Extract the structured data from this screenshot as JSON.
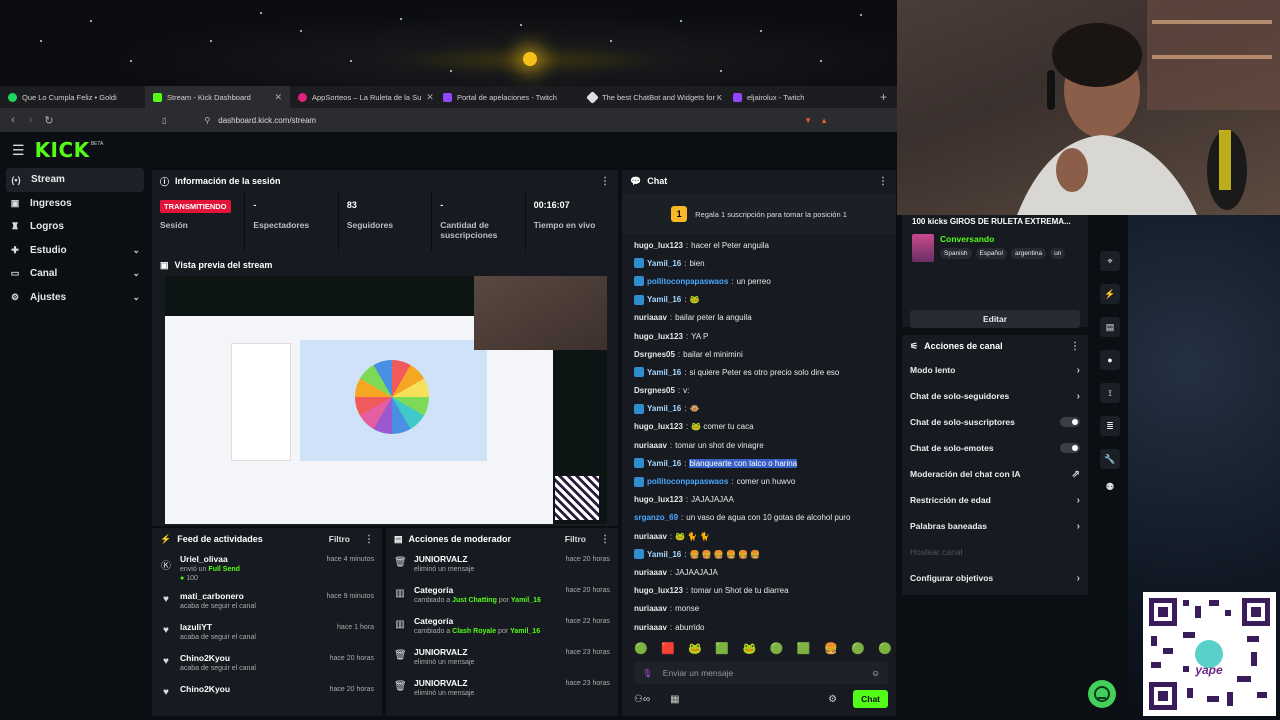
{
  "browser": {
    "tabs": [
      {
        "label": "Que Lo Cumpla Feliz • Goldi",
        "color": "#1ed760"
      },
      {
        "label": "Stream - Kick Dashboard",
        "color": "#53fc18"
      },
      {
        "label": "AppSorteos – La Ruleta de la Su",
        "color": "#e0207d"
      },
      {
        "label": "Portal de apelaciones - Twitch",
        "color": "#9146ff"
      },
      {
        "label": "The best ChatBot and Widgets for K",
        "color": "#dddddd"
      },
      {
        "label": "eljairolux - Twitch",
        "color": "#9146ff"
      }
    ],
    "url": "dashboard.kick.com/stream"
  },
  "kick": {
    "logo": "KICK",
    "beta": "BETA"
  },
  "sidebar": {
    "items": [
      {
        "label": "Stream"
      },
      {
        "label": "Ingresos"
      },
      {
        "label": "Logros"
      },
      {
        "label": "Estudio"
      },
      {
        "label": "Canal"
      },
      {
        "label": "Ajustes"
      }
    ]
  },
  "session": {
    "title": "Información de la sesión",
    "status": "TRANSMITIENDO",
    "status_label": "Sesión",
    "viewers_value": "-",
    "viewers_label": "Espectadores",
    "followers_value": "83",
    "followers_label": "Seguidores",
    "subs_value": "-",
    "subs_label": "Cantidad de suscripciones",
    "live_value": "00:16:07",
    "live_label": "Tiempo en vivo"
  },
  "preview": {
    "title": "Vista previa del stream"
  },
  "feed": {
    "title": "Feed de actividades",
    "filter": "Filtro",
    "items": [
      {
        "name": "Uriel_olivaa",
        "desc_pre": "envió un ",
        "desc_hl": "Full Send",
        "extra": "100",
        "time": "hace 4 minutos"
      },
      {
        "name": "mati_carbonero",
        "desc": "acaba de seguir el canal",
        "time": "hace 9 minutos"
      },
      {
        "name": "lazuliYT",
        "desc": "acaba de seguir el canal",
        "time": "hace 1 hora"
      },
      {
        "name": "Chino2Kyou",
        "desc": "acaba de seguir el canal",
        "time": "hace 20 horas"
      },
      {
        "name": "Chino2Kyou",
        "desc": "",
        "time": "hace 20 horas"
      }
    ]
  },
  "modactions": {
    "title": "Acciones de moderador",
    "filter": "Filtro",
    "items": [
      {
        "name": "JUNIORVALZ",
        "desc": "eliminó un mensaje",
        "time": "hace 20 horas"
      },
      {
        "name": "Categoría",
        "desc_pre": "cambiado a ",
        "desc_hl": "Just Chatting",
        "desc_mid": " por ",
        "desc_user": "Yamil_16",
        "time": "hace 20 horas"
      },
      {
        "name": "Categoría",
        "desc_pre": "cambiado a ",
        "desc_hl": "Clash Royale",
        "desc_mid": " por ",
        "desc_user": "Yamil_16",
        "time": "hace 22 horas"
      },
      {
        "name": "JUNIORVALZ",
        "desc": "eliminó un mensaje",
        "time": "hace 23 horas"
      },
      {
        "name": "JUNIORVALZ",
        "desc": "eliminó un mensaje",
        "time": "hace 23 horas"
      }
    ]
  },
  "chat": {
    "title": "Chat",
    "pin_number": "1",
    "pin_text": "Regala 1 suscripción para tomar la posición 1",
    "messages": [
      {
        "user": "hugo_lux123",
        "color": "#e7e7e7",
        "badge": false,
        "text": "hacer el Peter anguila"
      },
      {
        "user": "Yamil_16",
        "color": "#a6d8ff",
        "badge": true,
        "text": "bien"
      },
      {
        "user": "pollitoconpapaswaos",
        "color": "#4aa8ff",
        "badge": true,
        "text": "un perreo"
      },
      {
        "user": "Yamil_16",
        "color": "#a6d8ff",
        "badge": true,
        "text": "🐸"
      },
      {
        "user": "nuriaaav",
        "color": "#e7e7e7",
        "badge": false,
        "text": "bailar peter la anguila"
      },
      {
        "user": "hugo_lux123",
        "color": "#e7e7e7",
        "badge": false,
        "text": "YA P"
      },
      {
        "user": "Dsrgnes05",
        "color": "#e7e7e7",
        "badge": false,
        "text": "bailar el minimini"
      },
      {
        "user": "Yamil_16",
        "color": "#a6d8ff",
        "badge": true,
        "text": "si quiere Peter es otro precio solo dire eso"
      },
      {
        "user": "Dsrgnes05",
        "color": "#e7e7e7",
        "badge": false,
        "text": "v:"
      },
      {
        "user": "Yamil_16",
        "color": "#a6d8ff",
        "badge": true,
        "text": "🐵"
      },
      {
        "user": "hugo_lux123",
        "color": "#e7e7e7",
        "badge": false,
        "text": "🐸 comer tu caca"
      },
      {
        "user": "nuriaaav",
        "color": "#e7e7e7",
        "badge": false,
        "text": "tomar un shot de vinagre"
      },
      {
        "user": "Yamil_16",
        "color": "#a6d8ff",
        "badge": true,
        "text": "blanquearte con talco o harina",
        "highlight": true
      },
      {
        "user": "pollitoconpapaswaos",
        "color": "#4aa8ff",
        "badge": true,
        "text": "comer un huwvo"
      },
      {
        "user": "hugo_lux123",
        "color": "#e7e7e7",
        "badge": false,
        "text": "JAJAJAJAA"
      },
      {
        "user": "srganzo_69",
        "color": "#4aa8ff",
        "badge": false,
        "text": "un vaso de agua con 10 gotas de alcohol puro"
      },
      {
        "user": "nuriaaav",
        "color": "#e7e7e7",
        "badge": false,
        "text": "🐸 🐈 🐈"
      },
      {
        "user": "Yamil_16",
        "color": "#a6d8ff",
        "badge": true,
        "text": "🍔 🍔 🍔 🍔 🍔 🍔"
      },
      {
        "user": "nuriaaav",
        "color": "#e7e7e7",
        "badge": false,
        "text": "JAJAAJAJA"
      },
      {
        "user": "hugo_lux123",
        "color": "#e7e7e7",
        "badge": false,
        "text": "tomar un Shot de tu diarrea"
      },
      {
        "user": "nuriaaav",
        "color": "#e7e7e7",
        "badge": false,
        "text": "monse"
      },
      {
        "user": "nuriaaav",
        "color": "#e7e7e7",
        "badge": false,
        "text": "aburrido"
      }
    ],
    "emotes": [
      "🟢",
      "🟥",
      "🐸",
      "🟩",
      "🐸",
      "🟢",
      "🟩",
      "🍔",
      "🟢",
      "🟢"
    ],
    "input_placeholder": "Enviar un mensaje",
    "send_label": "Chat"
  },
  "streaminfo": {
    "title": "100 kicks GIROS DE RULETA EXTREMA...",
    "category": "Conversando",
    "tags": [
      "Spanish",
      "Español",
      "argentina",
      "un"
    ],
    "edit_label": "Editar"
  },
  "channel_actions": {
    "title": "Acciones de canal",
    "items": [
      {
        "label": "Modo lento",
        "kind": "chevron"
      },
      {
        "label": "Chat de solo-seguidores",
        "kind": "chevron"
      },
      {
        "label": "Chat de solo-suscriptores",
        "kind": "toggle"
      },
      {
        "label": "Chat de solo-emotes",
        "kind": "toggle"
      },
      {
        "label": "Moderación del chat con IA",
        "kind": "external"
      },
      {
        "label": "Restricción de edad",
        "kind": "chevron"
      },
      {
        "label": "Palabras baneadas",
        "kind": "chevron"
      },
      {
        "label": "Hostear canal",
        "kind": "disabled"
      },
      {
        "label": "Configurar objetivos",
        "kind": "chevron"
      }
    ]
  },
  "icons": {
    "chevron": "›",
    "external": "⇗"
  }
}
